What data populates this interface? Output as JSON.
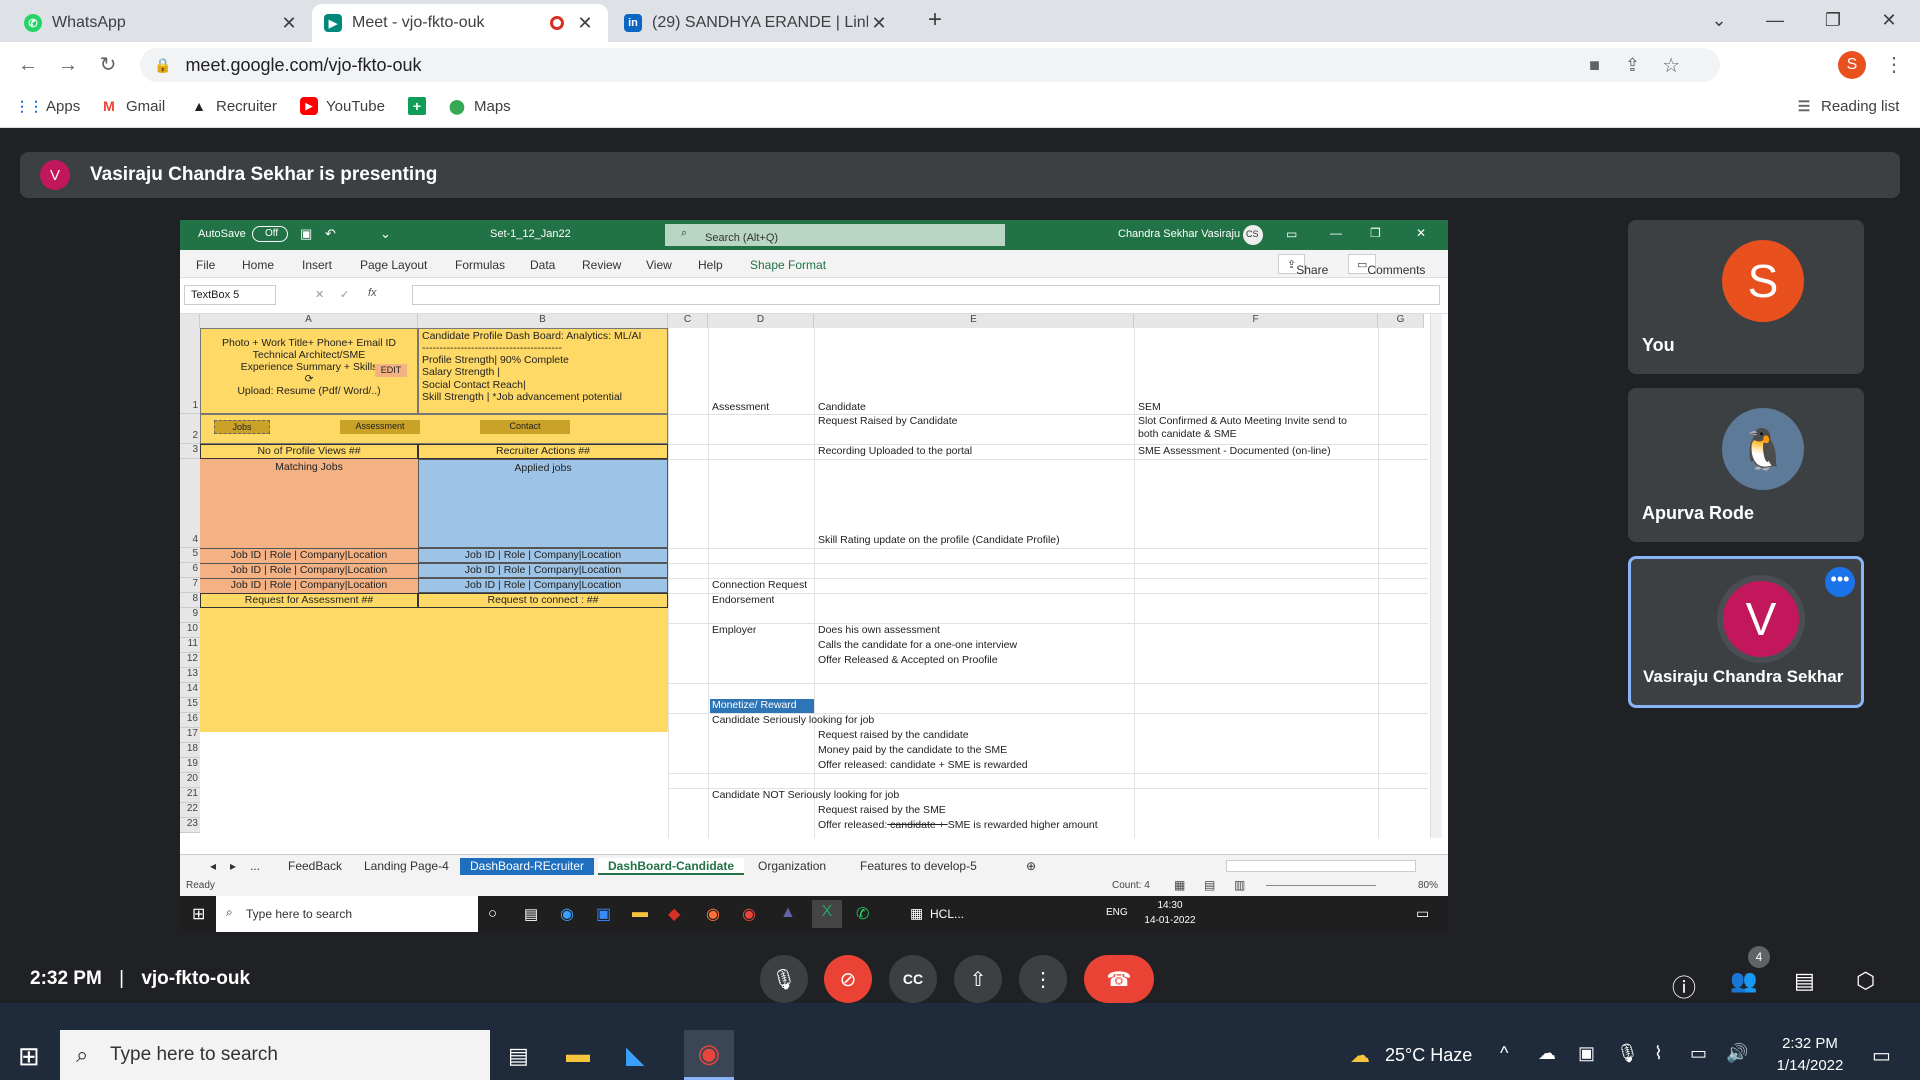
{
  "browser": {
    "tabs": [
      {
        "title": "WhatsApp",
        "icon": "whatsapp-icon",
        "color": "#25d366"
      },
      {
        "title": "Meet - vjo-fkto-ouk",
        "icon": "meet-icon",
        "color": "#00897b"
      },
      {
        "title": "(29) SANDHYA ERANDE | Linkedl",
        "icon": "linkedin-icon",
        "color": "#0a66c2"
      }
    ],
    "url": "meet.google.com/vjo-fkto-ouk",
    "profile_initial": "S",
    "bookmarks": [
      "Apps",
      "Gmail",
      "Recruiter",
      "YouTube",
      "Maps"
    ],
    "reading_list": "Reading list"
  },
  "meet": {
    "presenter_initial": "V",
    "presenting_text": "Vasiraju Chandra Sekhar is presenting",
    "time": "2:32 PM",
    "separator": "|",
    "meeting_code": "vjo-fkto-ouk",
    "participant_count": "4",
    "participants": [
      {
        "initial": "S",
        "name": "You",
        "color": "#e8501e"
      },
      {
        "initial": "",
        "name": "Apurva Rode",
        "color": "#5d7a99"
      },
      {
        "initial": "V",
        "name": "Vasiraju Chandra Sekhar",
        "color": "#c2185b"
      }
    ]
  },
  "excel": {
    "autosave": "AutoSave",
    "autosave_state": "Off",
    "filename": "Set-1_12_Jan22",
    "search": "Search (Alt+Q)",
    "user": "Chandra Sekhar Vasiraju",
    "user_initials": "CS",
    "menu": [
      "File",
      "Home",
      "Insert",
      "Page Layout",
      "Formulas",
      "Data",
      "Review",
      "View",
      "Help",
      "Shape Format"
    ],
    "share": "Share",
    "comments": "Comments",
    "namebox": "TextBox 5",
    "columns": [
      "A",
      "B",
      "C",
      "D",
      "E",
      "F",
      "G"
    ],
    "rows": [
      "1",
      "2",
      "3",
      "4",
      "5",
      "6",
      "7",
      "8",
      "9",
      "10",
      "11",
      "12",
      "13",
      "14",
      "15",
      "16",
      "17",
      "18",
      "19",
      "20",
      "21",
      "22",
      "23"
    ],
    "profile_box": [
      "Photo + Work Title+ Phone+ Email ID",
      "Technical Architect/SME",
      "Experience Summary + Skills",
      "Upload: Resume (Pdf/ Word/..)"
    ],
    "edit": "EDIT",
    "dashboard_box": [
      "Candidate Profile Dash Board: Analytics: ML/AI",
      "----------------------------------------",
      "Profile Strength| 90% Complete",
      "Salary Strength  |",
      "Social Contact Reach|",
      "Skill Strength  | *Job advancement potential"
    ],
    "btn_jobs": "Jobs",
    "btn_assessment": "Assessment",
    "btn_contact": "Contact",
    "profile_views": "No of Profile Views  ##",
    "recruiter_actions": "Recruiter Actions  ##",
    "matching_jobs": "Matching Jobs",
    "applied_jobs": "Applied jobs",
    "job_line": "Job ID | Role | Company|Location",
    "request_assessment": "Request for Assessment  ##",
    "request_connect": "Request to connect  : ##",
    "d_cells": {
      "r1": "Assessment",
      "r7": "Connection Request",
      "r8": "Endorsement",
      "r10": "Employer",
      "r15": "Monetize/ Reward",
      "r16": "Candidate Seriously looking for job",
      "r21": "Candidate NOT Seriously looking for job"
    },
    "e_cells": {
      "r1": "Candidate",
      "r2": "Request Raised by Candidate",
      "r3": "Recording Uploaded to  the portal",
      "r4": "Skill Rating update on the profile (Candidate Profile)",
      "r10": "Does his own assessment",
      "r11": "Calls the candidate for a one-one interview",
      "r12": "Offer Released & Accepted  on Proofile",
      "r17": "Request raised by the candidate",
      "r18": "Money paid by the candidate to the SME",
      "r19": "Offer released: candidate + SME is rewarded",
      "r22": "Request raised by the SME",
      "r23a": "Offer released:",
      "r23b": " candidate + ",
      "r23c": "SME is rewarded higher amount"
    },
    "f_cells": {
      "r1": "SEM",
      "r2a": "Slot Confirmed & Auto Meeting Invite send to",
      "r2b": "both canidate & SME",
      "r3": "SME Assessment - Documented (on-line)"
    },
    "sheets": [
      "...",
      "FeedBack",
      "Landing Page-4",
      "DashBoard-REcruiter",
      "DashBoard-Candidate",
      "Organization",
      "Features to develop-5"
    ],
    "status_ready": "Ready",
    "status_count": "Count: 4",
    "zoom": "80%",
    "taskbar_search": "Type here to search",
    "taskbar_hcl": "HCL...",
    "taskbar_lang": "ENG",
    "taskbar_time": "14:30",
    "taskbar_date": "14-01-2022"
  },
  "windows": {
    "search": "Type here to search",
    "weather": "25°C  Haze",
    "time": "2:32 PM",
    "date": "1/14/2022"
  }
}
